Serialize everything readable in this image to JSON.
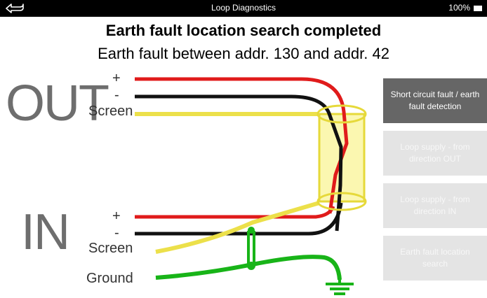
{
  "status_bar": {
    "title": "Loop Diagnostics",
    "battery": "100%"
  },
  "heading": "Earth fault location search completed",
  "subheading": "Earth fault between addr. 130 and addr. 42",
  "diagram": {
    "out_label": "OUT",
    "in_label": "IN",
    "out_plus": "+",
    "out_minus": "-",
    "out_screen": "Screen",
    "in_plus": "+",
    "in_minus": "-",
    "in_screen": "Screen",
    "ground": "Ground",
    "colors": {
      "plus": "#e01b1b",
      "minus": "#111111",
      "screen": "#ece04a",
      "ground": "#18b418"
    }
  },
  "side_menu": [
    {
      "label": "Short circuit fault / earth fault detection",
      "state": "active"
    },
    {
      "label": "Loop supply - from direction OUT",
      "state": "disabled"
    },
    {
      "label": "Loop supply - from direction IN",
      "state": "disabled"
    },
    {
      "label": "Earth fault location search",
      "state": "disabled"
    }
  ]
}
